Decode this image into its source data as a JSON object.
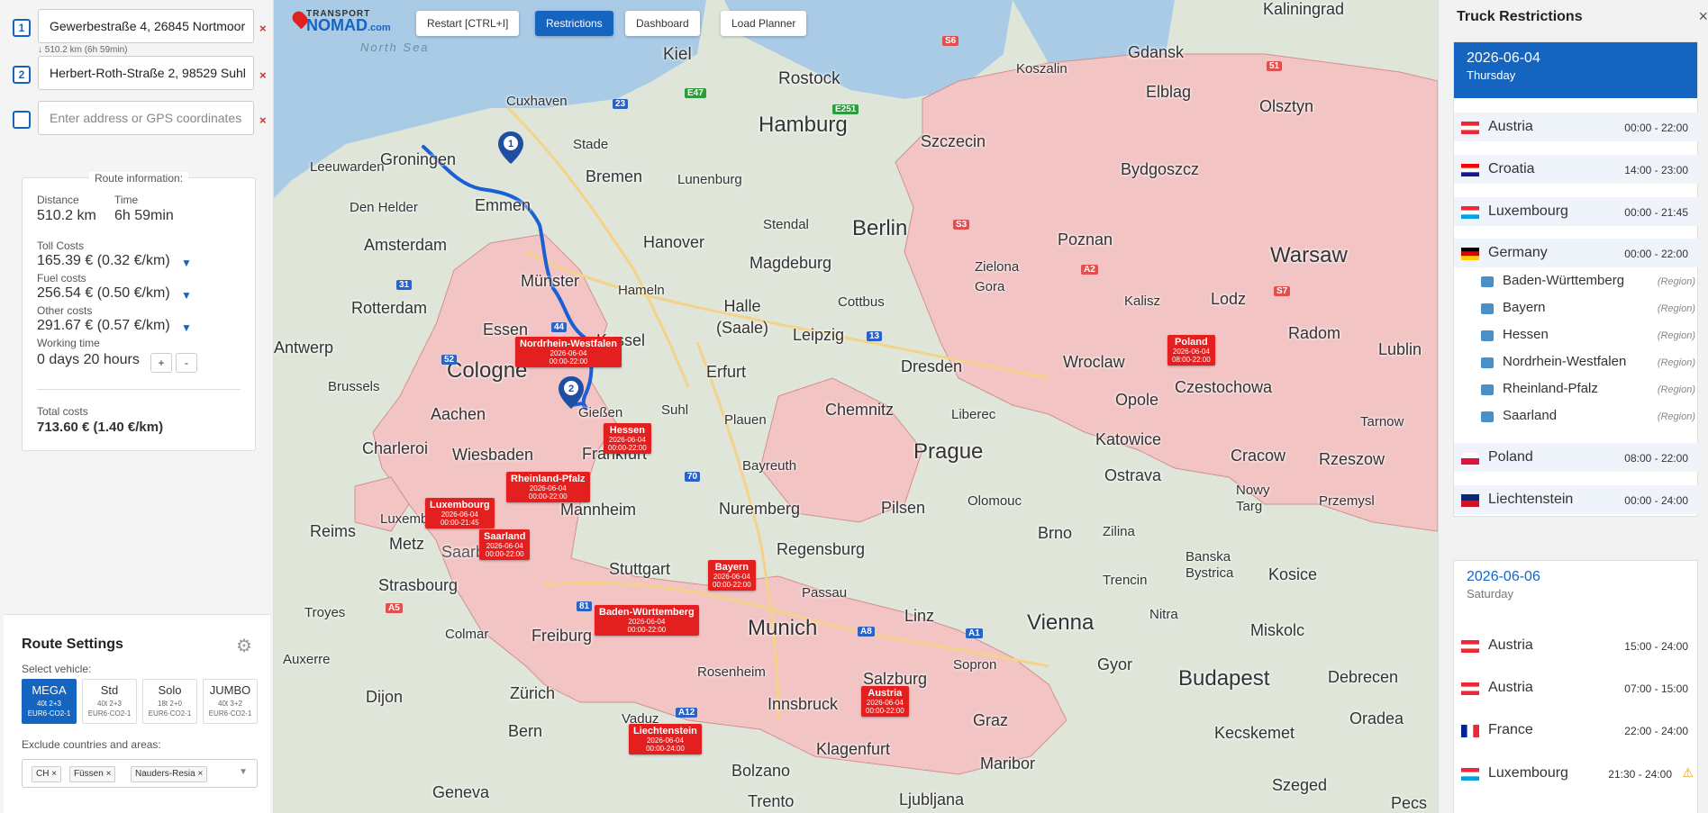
{
  "waypoints": [
    {
      "num": "1",
      "value": "Gewerbestraße 4, 26845 Nortmoor"
    },
    {
      "num": "2",
      "value": "Herbert-Roth-Straße 2, 98529 Suhl"
    },
    {
      "num": "",
      "value": "",
      "placeholder": "Enter address or GPS coordinates"
    }
  ],
  "leg_note": "↓ 510.2 km (6h 59min)",
  "route_info": {
    "title": "Route information:",
    "distance_label": "Distance",
    "distance": "510.2 km",
    "time_label": "Time",
    "time": "6h 59min",
    "toll_label": "Toll Costs",
    "toll": "165.39 € (0.32 €/km)",
    "fuel_label": "Fuel costs",
    "fuel": "256.54 € (0.50 €/km)",
    "other_label": "Other costs",
    "other": "291.67 € (0.57 €/km)",
    "working_label": "Working time",
    "working": "0 days 20 hours",
    "plus": "+",
    "minus": "-",
    "total_label": "Total costs",
    "total": "713.60 € (1.40 €/km)"
  },
  "route_settings": {
    "title": "Route Settings",
    "vehicle_label": "Select vehicle:",
    "vehicles": [
      {
        "name": "MEGA",
        "desc": "40t 2+3",
        "euro": "EUR6·CO2-1",
        "active": true
      },
      {
        "name": "Std",
        "desc": "40t 2+3",
        "euro": "EUR6·CO2-1"
      },
      {
        "name": "Solo",
        "desc": "18t 2+0",
        "euro": "EUR6·CO2-1"
      },
      {
        "name": "JUMBO",
        "desc": "40t 3+2",
        "euro": "EUR6·CO2-1"
      }
    ],
    "exclude_label": "Exclude countries and areas:",
    "exclude_tags": [
      "CH ×",
      "Füssen ×",
      "Nauders-Resia ×"
    ],
    "caret": "▼"
  },
  "map": {
    "logo_top": "TRANSPORT",
    "logo_bottom": "NOMAD",
    "logo_suffix": ".com",
    "buttons": {
      "restart": "Restart [CTRL+I]",
      "restrictions": "Restrictions",
      "dashboard": "Dashboard",
      "load_planner": "Load Planner"
    },
    "sea": "North Sea",
    "cities": [
      "Kiel",
      "Rostock",
      "Hamburg",
      "Cuxhaven",
      "Stade",
      "Leeuwarden",
      "Groningen",
      "Bremen",
      "Lunenburg",
      "Den Helder",
      "Emmen",
      "Amsterdam",
      "Hanover",
      "Stendal",
      "Berlin",
      "Magdeburg",
      "Münster",
      "Hameln",
      "Halle (Saale)",
      "Cottbus",
      "Rotterdam",
      "Essen",
      "Kassel",
      "Leipzig",
      "Antwerp",
      "Cologne",
      "Erfurt",
      "Dresden",
      "Brussels",
      "Aachen",
      "Suhl",
      "Plauen",
      "Chemnitz",
      "Gießen",
      "Frankfurt",
      "Wiesbaden",
      "Charleroi",
      "Prague",
      "Liberec",
      "Bayreuth",
      "Luxembourg",
      "Mannheim",
      "Nuremberg",
      "Pilsen",
      "Reims",
      "Metz",
      "Saarbrücke",
      "Regensburg",
      "Stuttgart",
      "Strasbourg",
      "Passau",
      "Munich",
      "Freiburg",
      "Linz",
      "Vienna",
      "Zürich",
      "Salzburg",
      "Innsbruck",
      "Graz",
      "Bern",
      "Vaduz",
      "Dijon",
      "Budapest",
      "Szczecin",
      "Gdansk",
      "Koszalin",
      "Elblag",
      "Olsztyn",
      "Bydgoszcz",
      "Poznan",
      "Warsaw",
      "Lodz",
      "Wroclaw",
      "Opole",
      "Katowice",
      "Czestochowa",
      "Radom",
      "Cracow",
      "Ostrava",
      "Brno",
      "Kaliningrad",
      "Zielona Gora",
      "Kalisz",
      "Rzeszow",
      "Lublin",
      "Olomouc",
      "Zilina",
      "Kosice",
      "Miskolc",
      "Debrecen",
      "Oradea",
      "Sopron",
      "Gyor",
      "Nitra",
      "Trencin",
      "Geneva",
      "Bolzano",
      "Klagenfurt",
      "Maribor",
      "Ljubljana",
      "Trento",
      "Troyes",
      "Auxerre",
      "Colmar",
      "Kecskemet",
      "Szeged",
      "Pecs",
      "Rosenheim",
      "Przemysl",
      "Banska Bystrica",
      "Nowy Targ",
      "Tarnow"
    ],
    "regions": [
      {
        "name": "Nordrhein-Westfalen",
        "date": "2026-06-04",
        "time": "00:00-22:00"
      },
      {
        "name": "Hessen",
        "date": "2026-06-04",
        "time": "00:00-22:00"
      },
      {
        "name": "Rheinland-Pfalz",
        "date": "2026-06-04",
        "time": "00:00-22:00"
      },
      {
        "name": "Luxembourg",
        "date": "2026-06-04",
        "time": "00:00-21:45"
      },
      {
        "name": "Saarland",
        "date": "2026-06-04",
        "time": "00:00-22:00"
      },
      {
        "name": "Bayern",
        "date": "2026-06-04",
        "time": "00:00-22:00"
      },
      {
        "name": "Baden-Württemberg",
        "date": "2026-06-04",
        "time": "00:00-22:00"
      },
      {
        "name": "Austria",
        "date": "2026-06-04",
        "time": "00:00-22:00"
      },
      {
        "name": "Liechtenstein",
        "date": "2026-06-04",
        "time": "00:00-24:00"
      },
      {
        "name": "Poland",
        "date": "2026-06-04",
        "time": "08:00-22:00"
      }
    ],
    "pins": [
      "1",
      "2"
    ],
    "route_color": "#1a5fd6",
    "restriction_fill": "#f2c4c4"
  },
  "panel": {
    "title": "Truck Restrictions",
    "close": "×",
    "days": [
      {
        "date": "2026-06-04",
        "weekday": "Thursday",
        "countries": [
          {
            "name": "Austria",
            "time": "00:00 - 22:00"
          },
          {
            "name": "Croatia",
            "time": "14:00 - 23:00"
          },
          {
            "name": "Luxembourg",
            "time": "00:00 - 21:45"
          },
          {
            "name": "Germany",
            "time": "00:00 - 22:00"
          }
        ],
        "regions": [
          "Baden-Württemberg",
          "Bayern",
          "Hessen",
          "Nordrhein-Westfalen",
          "Rheinland-Pfalz",
          "Saarland"
        ],
        "region_tag": "(Region)",
        "after": [
          {
            "name": "Poland",
            "time": "08:00 - 22:00"
          },
          {
            "name": "Liechtenstein",
            "time": "00:00 - 24:00"
          }
        ]
      },
      {
        "date": "2026-06-06",
        "weekday": "Saturday",
        "countries": [
          {
            "name": "Austria",
            "time": "15:00 - 24:00"
          },
          {
            "name": "Austria",
            "time": "07:00 - 15:00"
          },
          {
            "name": "France",
            "time": "22:00 - 24:00"
          },
          {
            "name": "Luxembourg",
            "time": "21:30 - 24:00",
            "warning": "⚠"
          }
        ]
      }
    ]
  },
  "colors": {
    "accent": "#1565c0",
    "danger": "#e41f1f"
  }
}
